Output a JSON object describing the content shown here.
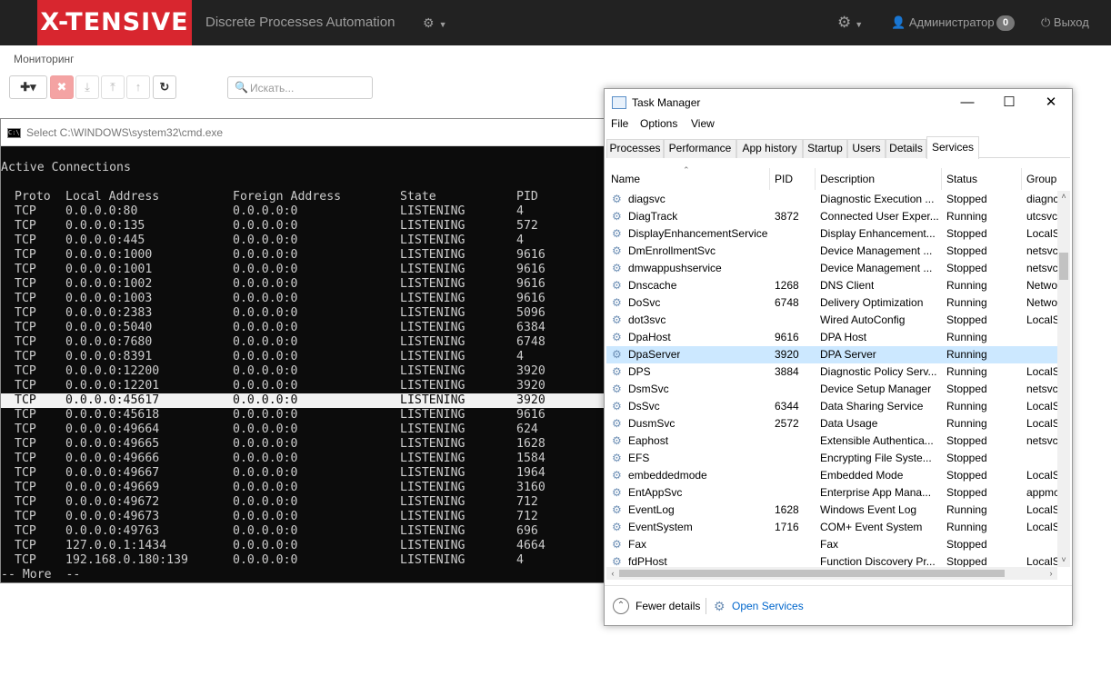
{
  "navbar": {
    "brand": "X-TENSIVE",
    "app_title": "Discrete Processes Automation",
    "network_icon": "network-icon",
    "settings_icon": "gear-icon",
    "user_icon": "user-icon",
    "user_name": "Администратор",
    "badge_count": "0",
    "logout_icon": "power-icon",
    "logout_label": "Выход",
    "brand_color": "#d8262f"
  },
  "page": {
    "title": "Мониторинг",
    "search_placeholder": "Искать..."
  },
  "toolbar": {
    "icons": [
      "add-icon",
      "delete-icon",
      "download-icon",
      "upload-icon",
      "export-icon",
      "refresh-icon"
    ]
  },
  "cmd": {
    "title": "Select C:\\WINDOWS\\system32\\cmd.exe",
    "heading": "Active Connections",
    "columns": [
      "Proto",
      "Local Address",
      "Foreign Address",
      "State",
      "PID"
    ],
    "rows": [
      [
        "TCP",
        "0.0.0.0:80",
        "0.0.0.0:0",
        "LISTENING",
        "4"
      ],
      [
        "TCP",
        "0.0.0.0:135",
        "0.0.0.0:0",
        "LISTENING",
        "572"
      ],
      [
        "TCP",
        "0.0.0.0:445",
        "0.0.0.0:0",
        "LISTENING",
        "4"
      ],
      [
        "TCP",
        "0.0.0.0:1000",
        "0.0.0.0:0",
        "LISTENING",
        "9616"
      ],
      [
        "TCP",
        "0.0.0.0:1001",
        "0.0.0.0:0",
        "LISTENING",
        "9616"
      ],
      [
        "TCP",
        "0.0.0.0:1002",
        "0.0.0.0:0",
        "LISTENING",
        "9616"
      ],
      [
        "TCP",
        "0.0.0.0:1003",
        "0.0.0.0:0",
        "LISTENING",
        "9616"
      ],
      [
        "TCP",
        "0.0.0.0:2383",
        "0.0.0.0:0",
        "LISTENING",
        "5096"
      ],
      [
        "TCP",
        "0.0.0.0:5040",
        "0.0.0.0:0",
        "LISTENING",
        "6384"
      ],
      [
        "TCP",
        "0.0.0.0:7680",
        "0.0.0.0:0",
        "LISTENING",
        "6748"
      ],
      [
        "TCP",
        "0.0.0.0:8391",
        "0.0.0.0:0",
        "LISTENING",
        "4"
      ],
      [
        "TCP",
        "0.0.0.0:12200",
        "0.0.0.0:0",
        "LISTENING",
        "3920"
      ],
      [
        "TCP",
        "0.0.0.0:12201",
        "0.0.0.0:0",
        "LISTENING",
        "3920"
      ],
      [
        "TCP",
        "0.0.0.0:45617",
        "0.0.0.0:0",
        "LISTENING",
        "3920"
      ],
      [
        "TCP",
        "0.0.0.0:45618",
        "0.0.0.0:0",
        "LISTENING",
        "9616"
      ],
      [
        "TCP",
        "0.0.0.0:49664",
        "0.0.0.0:0",
        "LISTENING",
        "624"
      ],
      [
        "TCP",
        "0.0.0.0:49665",
        "0.0.0.0:0",
        "LISTENING",
        "1628"
      ],
      [
        "TCP",
        "0.0.0.0:49666",
        "0.0.0.0:0",
        "LISTENING",
        "1584"
      ],
      [
        "TCP",
        "0.0.0.0:49667",
        "0.0.0.0:0",
        "LISTENING",
        "1964"
      ],
      [
        "TCP",
        "0.0.0.0:49669",
        "0.0.0.0:0",
        "LISTENING",
        "3160"
      ],
      [
        "TCP",
        "0.0.0.0:49672",
        "0.0.0.0:0",
        "LISTENING",
        "712"
      ],
      [
        "TCP",
        "0.0.0.0:49673",
        "0.0.0.0:0",
        "LISTENING",
        "712"
      ],
      [
        "TCP",
        "0.0.0.0:49763",
        "0.0.0.0:0",
        "LISTENING",
        "696"
      ],
      [
        "TCP",
        "127.0.0.1:1434",
        "0.0.0.0:0",
        "LISTENING",
        "4664"
      ],
      [
        "TCP",
        "192.168.0.180:139",
        "0.0.0.0:0",
        "LISTENING",
        "4"
      ]
    ],
    "highlighted_row": 13,
    "more": "-- More  --"
  },
  "taskmgr": {
    "title": "Task Manager",
    "menu": [
      "File",
      "Options",
      "View"
    ],
    "tabs": [
      "Processes",
      "Performance",
      "App history",
      "Startup",
      "Users",
      "Details",
      "Services"
    ],
    "active_tab": "Services",
    "columns": [
      "Name",
      "PID",
      "Description",
      "Status",
      "Group"
    ],
    "services": [
      [
        "diagsvc",
        "",
        "Diagnostic Execution ...",
        "Stopped",
        "diagnc"
      ],
      [
        "DiagTrack",
        "3872",
        "Connected User Exper...",
        "Running",
        "utcsvc"
      ],
      [
        "DisplayEnhancementService",
        "",
        "Display Enhancement...",
        "Stopped",
        "LocalS"
      ],
      [
        "DmEnrollmentSvc",
        "",
        "Device Management ...",
        "Stopped",
        "netsvc"
      ],
      [
        "dmwappushservice",
        "",
        "Device Management ...",
        "Stopped",
        "netsvc"
      ],
      [
        "Dnscache",
        "1268",
        "DNS Client",
        "Running",
        "Netwo"
      ],
      [
        "DoSvc",
        "6748",
        "Delivery Optimization",
        "Running",
        "Netwo"
      ],
      [
        "dot3svc",
        "",
        "Wired AutoConfig",
        "Stopped",
        "LocalS"
      ],
      [
        "DpaHost",
        "9616",
        "DPA Host",
        "Running",
        ""
      ],
      [
        "DpaServer",
        "3920",
        "DPA Server",
        "Running",
        ""
      ],
      [
        "DPS",
        "3884",
        "Diagnostic Policy Serv...",
        "Running",
        "LocalS"
      ],
      [
        "DsmSvc",
        "",
        "Device Setup Manager",
        "Stopped",
        "netsvc"
      ],
      [
        "DsSvc",
        "6344",
        "Data Sharing Service",
        "Running",
        "LocalS"
      ],
      [
        "DusmSvc",
        "2572",
        "Data Usage",
        "Running",
        "LocalS"
      ],
      [
        "Eaphost",
        "",
        "Extensible Authentica...",
        "Stopped",
        "netsvc"
      ],
      [
        "EFS",
        "",
        "Encrypting File Syste...",
        "Stopped",
        ""
      ],
      [
        "embeddedmode",
        "",
        "Embedded Mode",
        "Stopped",
        "LocalS"
      ],
      [
        "EntAppSvc",
        "",
        "Enterprise App Mana...",
        "Stopped",
        "appmc"
      ],
      [
        "EventLog",
        "1628",
        "Windows Event Log",
        "Running",
        "LocalS"
      ],
      [
        "EventSystem",
        "1716",
        "COM+ Event System",
        "Running",
        "LocalS"
      ],
      [
        "Fax",
        "",
        "Fax",
        "Stopped",
        ""
      ],
      [
        "fdPHost",
        "",
        "Function Discovery Pr...",
        "Stopped",
        "LocalS"
      ]
    ],
    "selected_row": 9,
    "fewer_details": "Fewer details",
    "open_services": "Open Services",
    "selection_color": "#cce8ff",
    "link_color": "#0066cc"
  }
}
